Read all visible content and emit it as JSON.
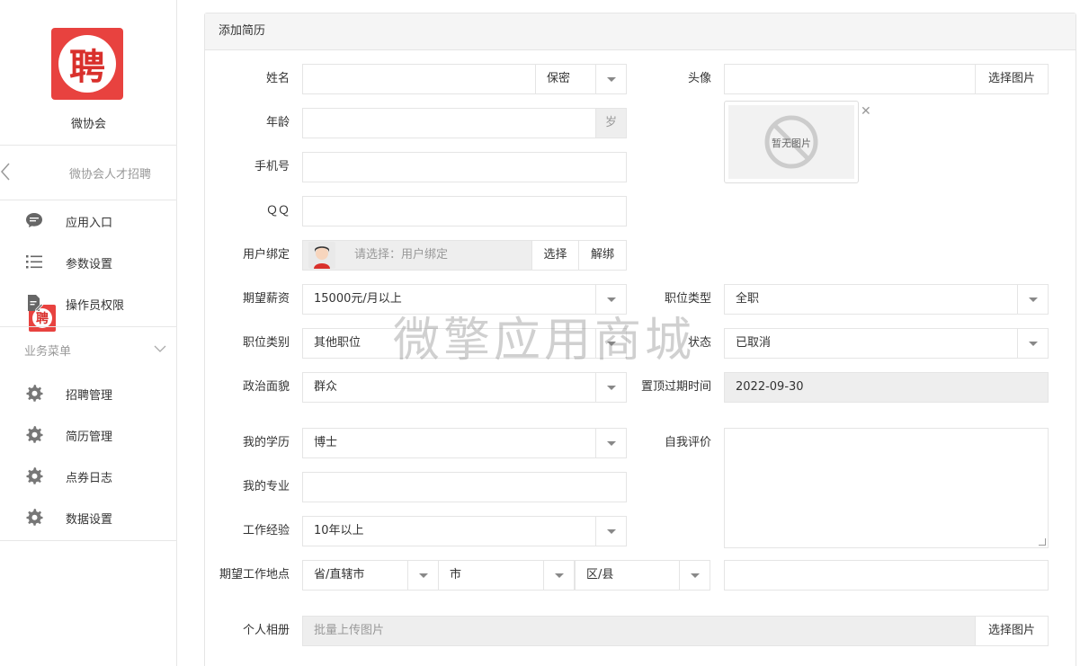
{
  "sidebar": {
    "logo_char": "聘",
    "site_name": "微协会",
    "app_name": "微协会人才招聘",
    "nav": [
      {
        "label": "应用入口",
        "icon": "chat-icon"
      },
      {
        "label": "参数设置",
        "icon": "list-icon"
      },
      {
        "label": "操作员权限",
        "icon": "edit-doc-icon"
      }
    ],
    "group_title": "业务菜单",
    "business": [
      {
        "label": "招聘管理",
        "icon": "gear-icon"
      },
      {
        "label": "简历管理",
        "icon": "gear-icon"
      },
      {
        "label": "点券日志",
        "icon": "gear-icon"
      },
      {
        "label": "数据设置",
        "icon": "gear-icon"
      }
    ]
  },
  "panel": {
    "title": "添加简历"
  },
  "form": {
    "name_label": "姓名",
    "gender_value": "保密",
    "age_label": "年龄",
    "age_unit": "岁",
    "phone_label": "手机号",
    "qq_label": "ＱＱ",
    "user_bind_label": "用户绑定",
    "user_bind_placeholder": "请选择：用户绑定",
    "select_btn": "选择",
    "unbind_btn": "解绑",
    "salary_label": "期望薪资",
    "salary_value": "15000元/月以上",
    "job_category_label": "职位类别",
    "job_category_value": "其他职位",
    "politics_label": "政治面貌",
    "politics_value": "群众",
    "education_label": "我的学历",
    "education_value": "博士",
    "major_label": "我的专业",
    "experience_label": "工作经验",
    "experience_value": "10年以上",
    "location_label": "期望工作地点",
    "province_value": "省/直辖市",
    "city_value": "市",
    "district_value": "区/县",
    "album_label": "个人相册",
    "album_placeholder": "批量上传图片",
    "choose_image_btn": "选择图片",
    "avatar_label": "头像",
    "no_image_text": "暂无图片",
    "job_type_label": "职位类型",
    "job_type_value": "全职",
    "status_label": "状态",
    "status_value": "已取消",
    "top_expire_label": "置顶过期时间",
    "top_expire_value": "2022-09-30",
    "self_eval_label": "自我评价"
  },
  "watermark": "微擎应用商城"
}
